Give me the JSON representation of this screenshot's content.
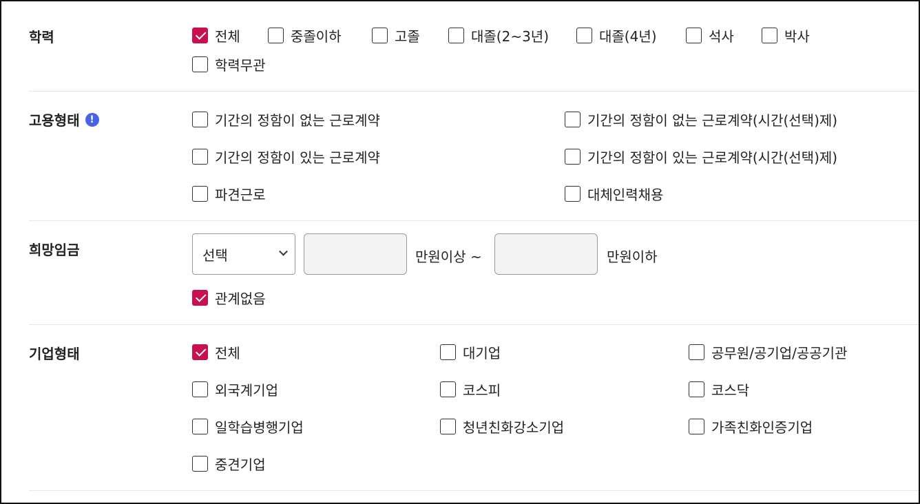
{
  "education": {
    "title": "학력",
    "options": [
      {
        "label": "전체",
        "checked": true
      },
      {
        "label": "중졸이하",
        "checked": false
      },
      {
        "label": "고졸",
        "checked": false
      },
      {
        "label": "대졸(2~3년)",
        "checked": false
      },
      {
        "label": "대졸(4년)",
        "checked": false
      },
      {
        "label": "석사",
        "checked": false
      },
      {
        "label": "박사",
        "checked": false
      },
      {
        "label": "학력무관",
        "checked": false
      }
    ]
  },
  "employment": {
    "title": "고용형태",
    "info_icon": "!",
    "options": [
      {
        "label": "기간의 정함이 없는 근로계약",
        "checked": false
      },
      {
        "label": "기간의 정함이 없는 근로계약(시간(선택)제)",
        "checked": false
      },
      {
        "label": "기간의 정함이 있는 근로계약",
        "checked": false
      },
      {
        "label": "기간의 정함이 있는 근로계약(시간(선택)제)",
        "checked": false
      },
      {
        "label": "파견근로",
        "checked": false
      },
      {
        "label": "대체인력채용",
        "checked": false
      }
    ]
  },
  "salary": {
    "title": "희망임금",
    "select_value": "선택",
    "min_value": "",
    "min_suffix": "만원이상 ~",
    "max_value": "",
    "max_suffix": "만원이하",
    "none_option": {
      "label": "관계없음",
      "checked": true
    }
  },
  "company": {
    "title": "기업형태",
    "options": [
      {
        "label": "전체",
        "checked": true
      },
      {
        "label": "대기업",
        "checked": false
      },
      {
        "label": "공무원/공기업/공공기관",
        "checked": false
      },
      {
        "label": "외국계기업",
        "checked": false
      },
      {
        "label": "코스피",
        "checked": false
      },
      {
        "label": "코스닥",
        "checked": false
      },
      {
        "label": "일학습병행기업",
        "checked": false
      },
      {
        "label": "청년친화강소기업",
        "checked": false
      },
      {
        "label": "가족친화인증기업",
        "checked": false
      },
      {
        "label": "중견기업",
        "checked": false
      }
    ]
  },
  "colors": {
    "accent": "#c8104f",
    "info": "#4a63e6"
  }
}
